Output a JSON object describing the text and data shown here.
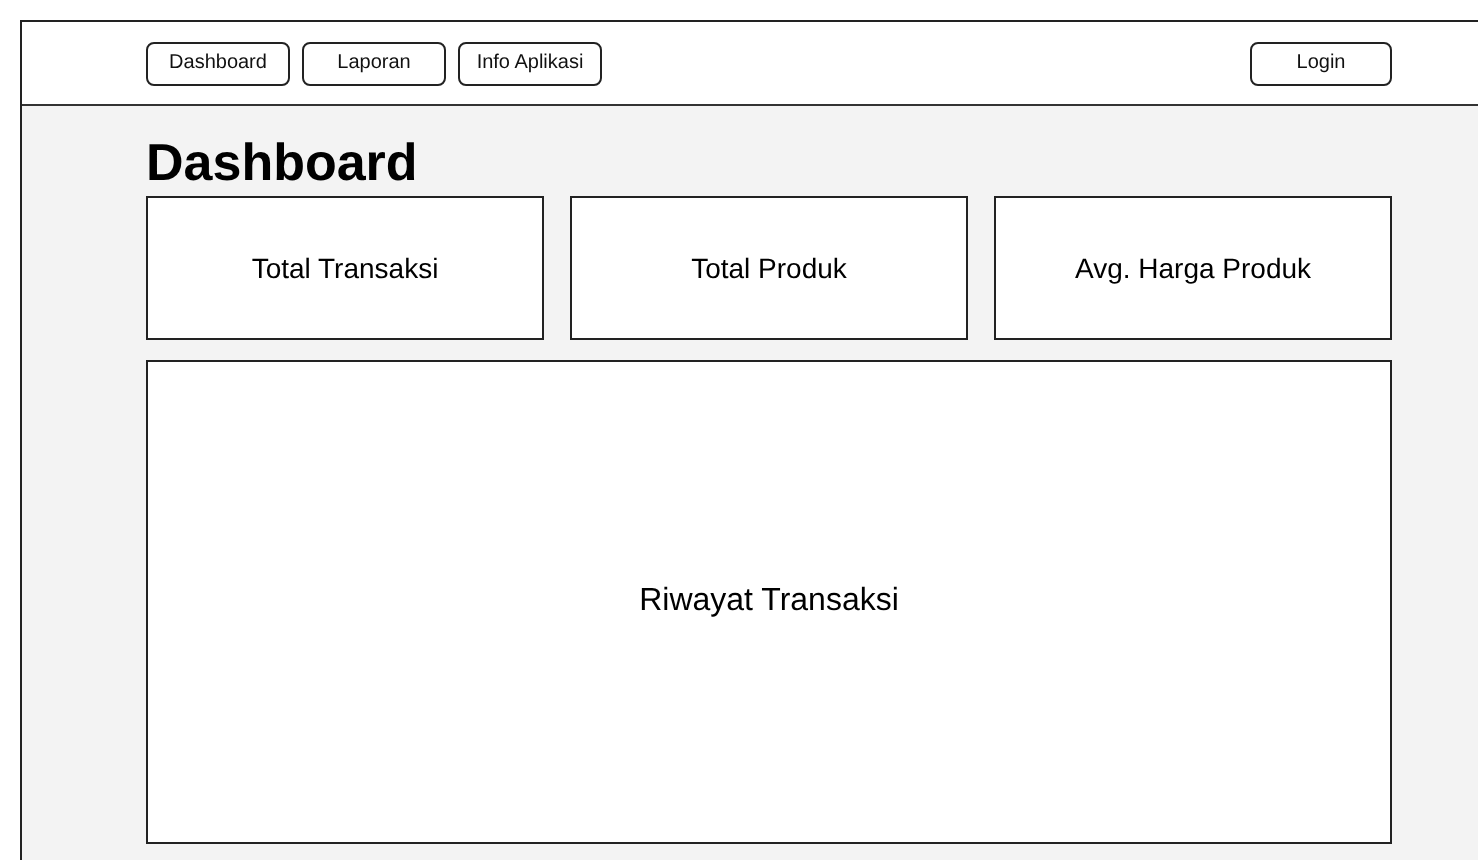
{
  "nav": [
    {
      "label": "Dashboard"
    },
    {
      "label": "Laporan"
    },
    {
      "label": "Info Aplikasi"
    }
  ],
  "login": {
    "label": "Login"
  },
  "page_title": "Dashboard",
  "cards": [
    {
      "label": "Total Transaksi"
    },
    {
      "label": "Total Produk"
    },
    {
      "label": "Avg. Harga Produk"
    }
  ],
  "history_panel": {
    "label": "Riwayat Transaksi"
  }
}
